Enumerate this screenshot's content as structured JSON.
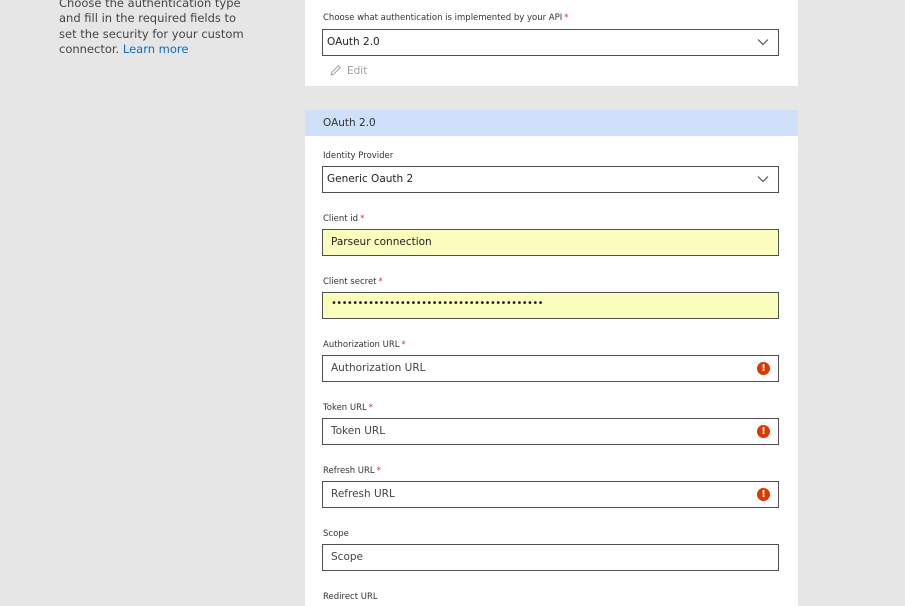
{
  "left": {
    "description": "Choose the authentication type and fill in the required fields to set the security for your custom connector.",
    "learn_more": "Learn more"
  },
  "auth_type": {
    "label": "Choose what authentication is implemented by your API",
    "required_mark": "*",
    "value": "OAuth 2.0",
    "edit_label": "Edit"
  },
  "oauth": {
    "section_title": "OAuth 2.0",
    "identity_provider": {
      "label": "Identity Provider",
      "value": "Generic Oauth 2"
    },
    "client_id": {
      "label": "Client id",
      "required_mark": "*",
      "value": "Parseur connection"
    },
    "client_secret": {
      "label": "Client secret",
      "required_mark": "*",
      "value": "••••••••••••••••••••••••••••••••••••••••"
    },
    "authorization_url": {
      "label": "Authorization URL",
      "required_mark": "*",
      "placeholder": "Authorization URL",
      "error_icon": "!"
    },
    "token_url": {
      "label": "Token URL",
      "required_mark": "*",
      "placeholder": "Token URL",
      "error_icon": "!"
    },
    "refresh_url": {
      "label": "Refresh URL",
      "required_mark": "*",
      "placeholder": "Refresh URL",
      "error_icon": "!"
    },
    "scope": {
      "label": "Scope",
      "placeholder": "Scope"
    },
    "redirect_url": {
      "label": "Redirect URL"
    }
  },
  "colors": {
    "background": "#e6e6e6",
    "panel": "#ffffff",
    "section_header": "#cfe0fb",
    "filled_input": "#fbfdbc",
    "error": "#d83b01",
    "link": "#0f6cbd",
    "required": "#c4314b"
  }
}
